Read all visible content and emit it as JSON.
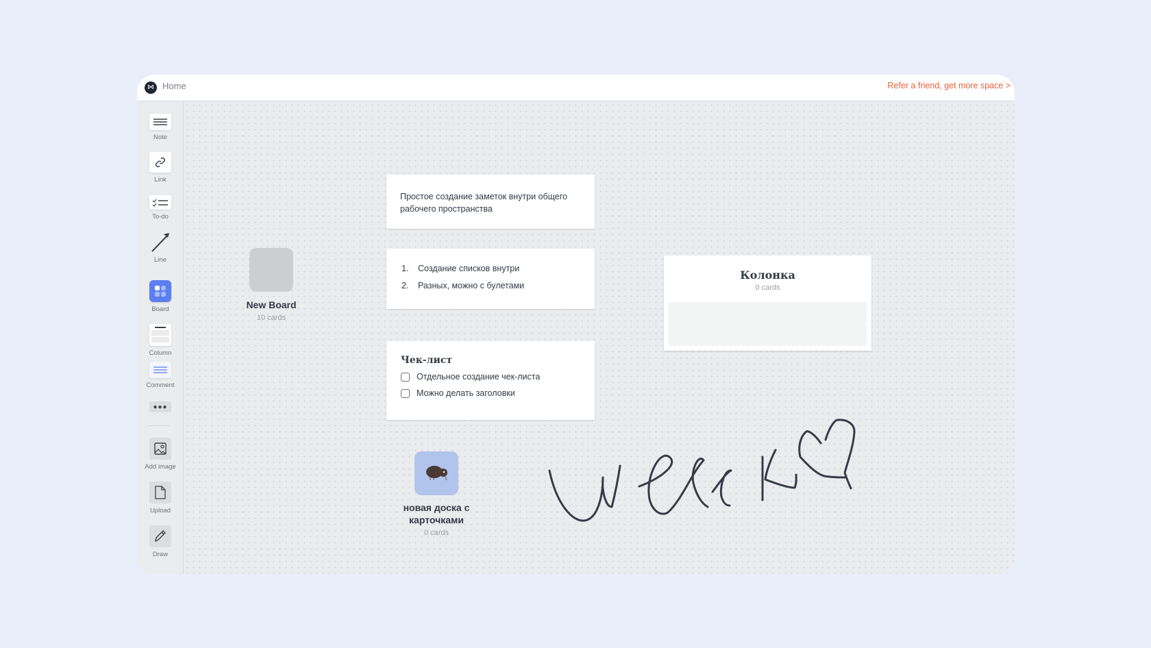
{
  "header": {
    "title": "Home",
    "refer_link": "Refer a friend, get more space >"
  },
  "sidebar": {
    "items": [
      {
        "label": "Note",
        "icon": "note-icon"
      },
      {
        "label": "Link",
        "icon": "link-icon"
      },
      {
        "label": "To-do",
        "icon": "todo-icon"
      },
      {
        "label": "Line",
        "icon": "arrow-line-icon"
      },
      {
        "label": "Board",
        "icon": "board-icon"
      },
      {
        "label": "Column",
        "icon": "column-icon"
      },
      {
        "label": "Comment",
        "icon": "comment-icon"
      },
      {
        "label": "Add image",
        "icon": "image-icon"
      },
      {
        "label": "Upload",
        "icon": "file-icon"
      },
      {
        "label": "Draw",
        "icon": "pencil-icon"
      }
    ],
    "accent": "#5b7ff0"
  },
  "canvas": {
    "note": {
      "text": "Простое создание заметок внутри общего рабочего пространства"
    },
    "list": {
      "items": [
        {
          "num": "1.",
          "text": "Создание списков внутри"
        },
        {
          "num": "2.",
          "text": "Разных, можно с булетами"
        }
      ]
    },
    "checklist": {
      "title": "Чек-лист",
      "items": [
        {
          "text": "Отдельное создание чек-листа",
          "checked": false
        },
        {
          "text": "Можно делать заголовки",
          "checked": false
        }
      ]
    },
    "boards": [
      {
        "title": "New Board",
        "count": "10 cards",
        "color": "#cdced1"
      },
      {
        "title": "новая доска с карточками",
        "count": "0 cards",
        "color": "#b1c4ec",
        "icon": "kiwi-icon"
      }
    ],
    "column": {
      "title": "Колонка",
      "count": "0 cards"
    },
    "drawing": {
      "text": "weeek"
    }
  },
  "refer_color": "#e8623d"
}
